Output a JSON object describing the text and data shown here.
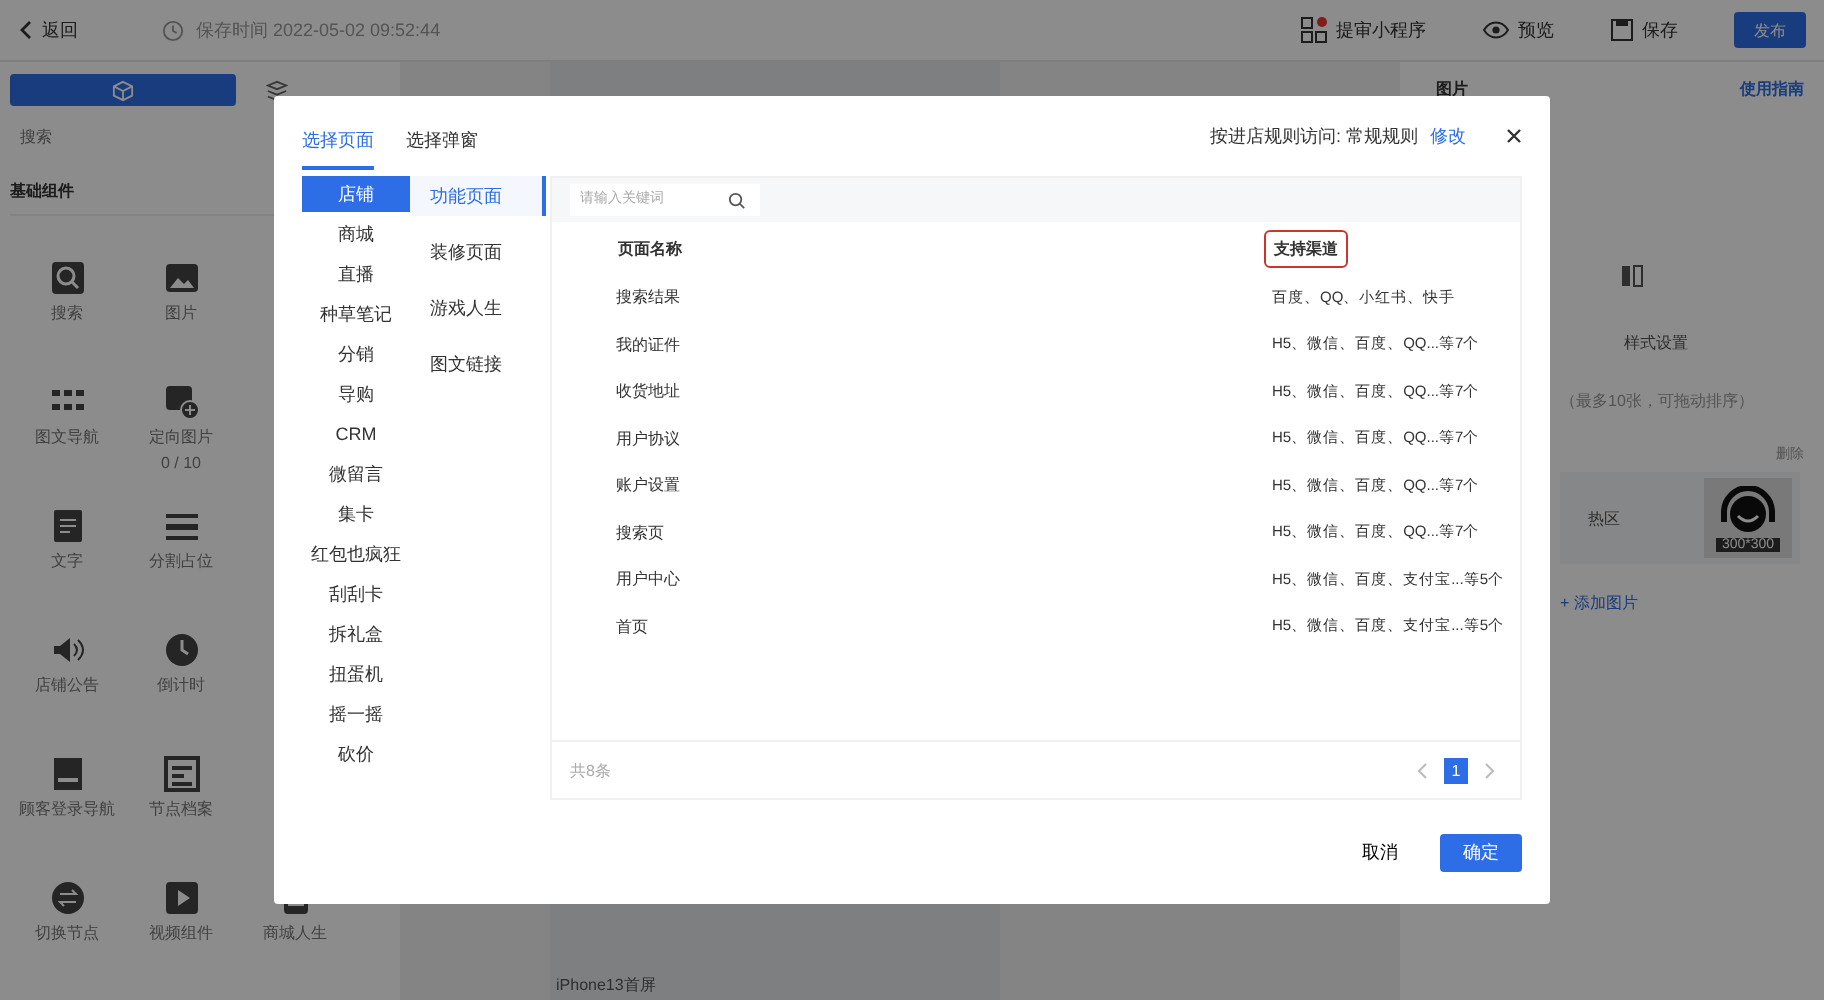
{
  "app_header": {
    "back": "返回",
    "save_time": "保存时间 2022-05-02 09:52:44",
    "actions": [
      {
        "label": "提审小程序"
      },
      {
        "label": "预览"
      },
      {
        "label": "保存"
      }
    ],
    "publish": "发布"
  },
  "sidebar": {
    "tabs": [
      {
        "selected": true
      },
      {
        "selected": false
      }
    ],
    "search_placeholder": "搜索",
    "section": "基础组件",
    "components": [
      {
        "label": "搜索",
        "kind": "search"
      },
      {
        "label": "图片",
        "kind": "image"
      },
      {
        "kind": "hidden"
      },
      {
        "label": "图文导航",
        "kind": "grid"
      },
      {
        "label": "定向图片",
        "sub": "0 / 10",
        "kind": "imageplus"
      },
      {
        "kind": "hidden"
      },
      {
        "label": "文字",
        "kind": "text"
      },
      {
        "label": "分割占位",
        "kind": "divider"
      },
      {
        "kind": "hidden"
      },
      {
        "label": "店铺公告",
        "kind": "speaker"
      },
      {
        "label": "倒计时",
        "kind": "clock"
      },
      {
        "kind": "hidden"
      },
      {
        "label": "顾客登录导航",
        "kind": "doc"
      },
      {
        "label": "节点档案",
        "kind": "list"
      },
      {
        "kind": "hidden"
      },
      {
        "label": "切换节点",
        "kind": "switch"
      },
      {
        "label": "视频组件",
        "kind": "play"
      },
      {
        "label": "商城人生",
        "kind": "phone"
      }
    ]
  },
  "canvas": {
    "screen_label": "iPhone13首屏"
  },
  "right_panel": {
    "title": "图片",
    "guide": "使用指南",
    "style_tab": "样式设置",
    "hint": "（最多10张，可拖动排序）",
    "delete": "删除",
    "hotspot": "热区",
    "thumb_label": "300*300",
    "add": "+ 添加图片"
  },
  "dialog": {
    "tabs": [
      {
        "label": "选择页面",
        "selected": true
      },
      {
        "label": "选择弹窗",
        "selected": false
      }
    ],
    "rule_label": "按进店规则访问: 常规规则",
    "rule_link": "修改",
    "categories": [
      {
        "label": "店铺",
        "selected": true
      },
      {
        "label": "商城",
        "selected": false
      },
      {
        "label": "直播",
        "selected": false
      },
      {
        "label": "种草笔记",
        "selected": false
      },
      {
        "label": "分销",
        "selected": false
      },
      {
        "label": "导购",
        "selected": false
      },
      {
        "label": "CRM",
        "selected": false
      },
      {
        "label": "微留言",
        "selected": false
      },
      {
        "label": "集卡",
        "selected": false
      },
      {
        "label": "红包也疯狂",
        "selected": false
      },
      {
        "label": "刮刮卡",
        "selected": false
      },
      {
        "label": "拆礼盒",
        "selected": false
      },
      {
        "label": "扭蛋机",
        "selected": false
      },
      {
        "label": "摇一摇",
        "selected": false
      },
      {
        "label": "砍价",
        "selected": false
      }
    ],
    "subcategories": [
      {
        "label": "功能页面",
        "selected": true
      },
      {
        "label": "装修页面",
        "selected": false
      },
      {
        "label": "游戏人生",
        "selected": false
      },
      {
        "label": "图文链接",
        "selected": false
      }
    ],
    "search_placeholder": "请输入关键词",
    "columns": [
      {
        "label": "页面名称",
        "highlighted": false
      },
      {
        "label": "支持渠道",
        "highlighted": true
      }
    ],
    "rows": [
      {
        "name": "搜索结果",
        "channels": "百度、QQ、小红书、快手"
      },
      {
        "name": "我的证件",
        "channels": "H5、微信、百度、QQ...等7个"
      },
      {
        "name": "收货地址",
        "channels": "H5、微信、百度、QQ...等7个"
      },
      {
        "name": "用户协议",
        "channels": "H5、微信、百度、QQ...等7个"
      },
      {
        "name": "账户设置",
        "channels": "H5、微信、百度、QQ...等7个"
      },
      {
        "name": "搜索页",
        "channels": "H5、微信、百度、QQ...等7个"
      },
      {
        "name": "用户中心",
        "channels": "H5、微信、百度、支付宝...等5个"
      },
      {
        "name": "首页",
        "channels": "H5、微信、百度、支付宝...等5个"
      }
    ],
    "total": "共8条",
    "pages": [
      {
        "label": "1",
        "selected": true
      }
    ],
    "cancel": "取消",
    "confirm": "确定"
  }
}
